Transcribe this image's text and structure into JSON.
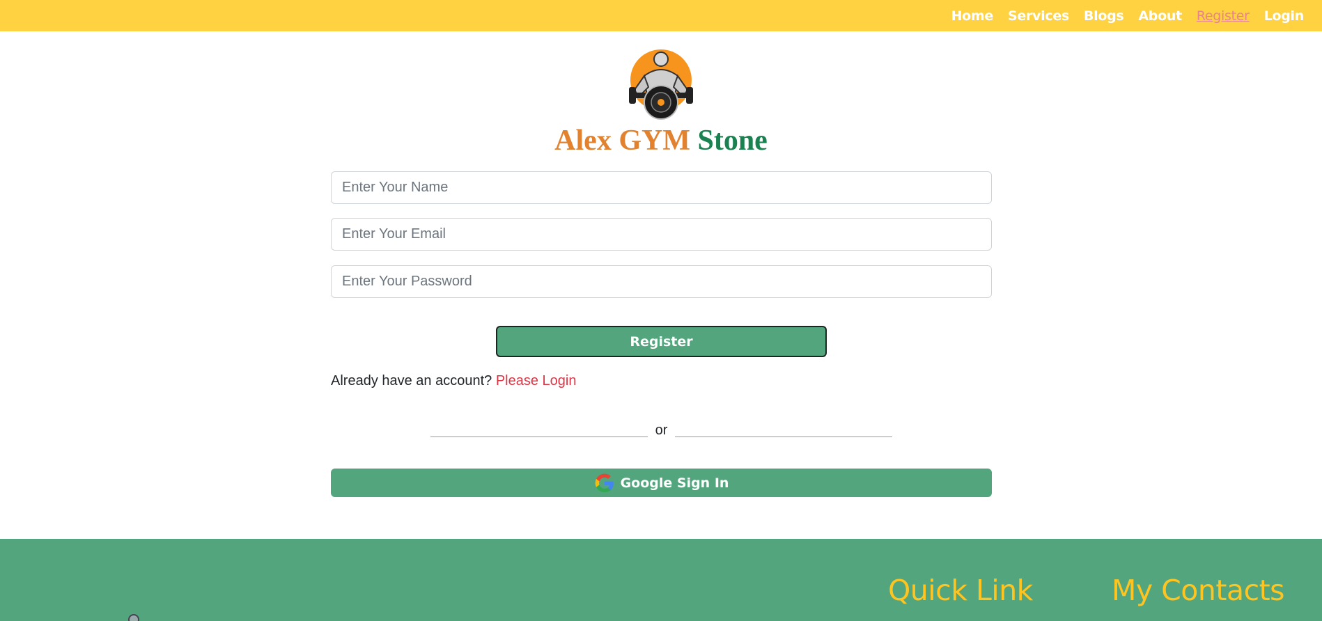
{
  "nav": {
    "items": [
      {
        "label": "Home"
      },
      {
        "label": "Services"
      },
      {
        "label": "Blogs"
      },
      {
        "label": "About"
      },
      {
        "label": "Register"
      },
      {
        "label": "Login"
      }
    ],
    "active": "Register"
  },
  "brand": {
    "part1": "Alex GYM",
    "part2": "Stone",
    "color1": "#e2812e",
    "color2": "#1a8250",
    "logo_icon": "bodybuilder-logo-icon"
  },
  "form": {
    "name_placeholder": "Enter Your Name",
    "email_placeholder": "Enter Your Email",
    "password_placeholder": "Enter Your Password",
    "submit_label": "Register",
    "login_prompt": "Already have an account?",
    "login_link": "Please Login",
    "divider_text": "or",
    "google_label": "Google Sign In",
    "google_icon": "google-icon"
  },
  "footer": {
    "quick_link_heading": "Quick Link",
    "contacts_heading": "My Contacts"
  },
  "colors": {
    "navbar": "#ffd242",
    "button": "#52a57d",
    "footer": "#52a57d",
    "footer_heading": "#ffc41f",
    "link": "#dc3545"
  }
}
